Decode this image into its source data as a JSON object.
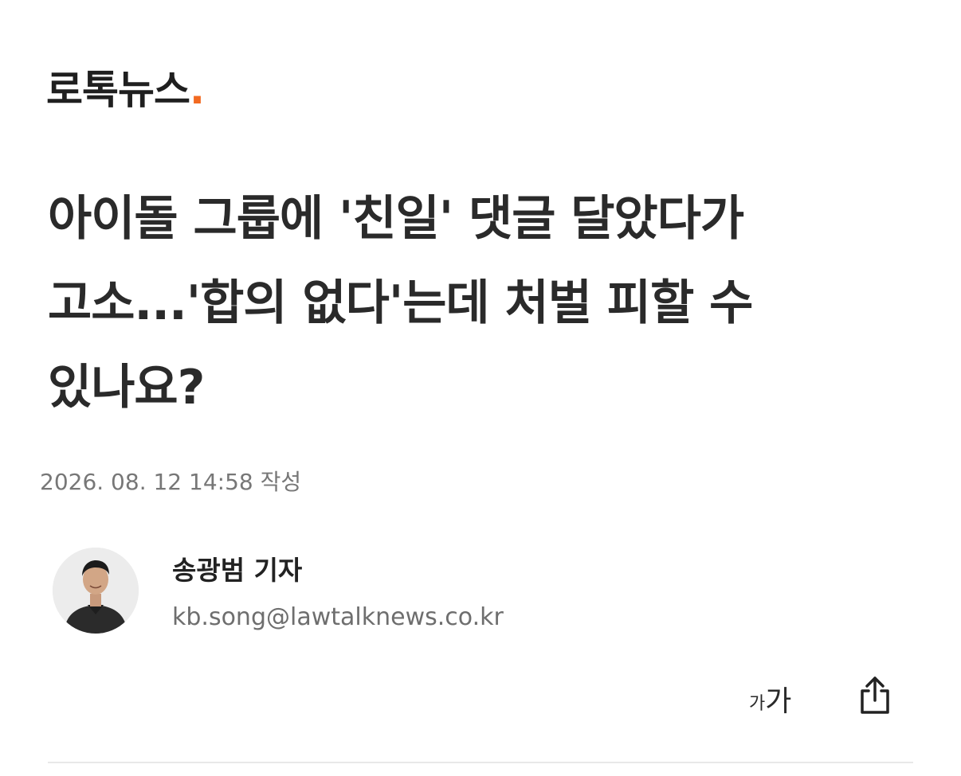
{
  "header": {
    "logo_text": "로톡뉴스",
    "logo_dot": ".",
    "logo_dot_color": "#f26a21"
  },
  "article": {
    "title": "아이돌 그룹에 '친일' 댓글 달았다가 고소...'합의 없다'는데 처벌 피할 수 있나요?",
    "date": "2026. 08. 12 14:58 작성"
  },
  "author": {
    "name": "송광범 기자",
    "email": "kb.song@lawtalknews.co.kr",
    "avatar_icon": "author-photo"
  },
  "toolbar": {
    "font_size_small": "가",
    "font_size_large": "가",
    "share_icon": "share-icon"
  }
}
